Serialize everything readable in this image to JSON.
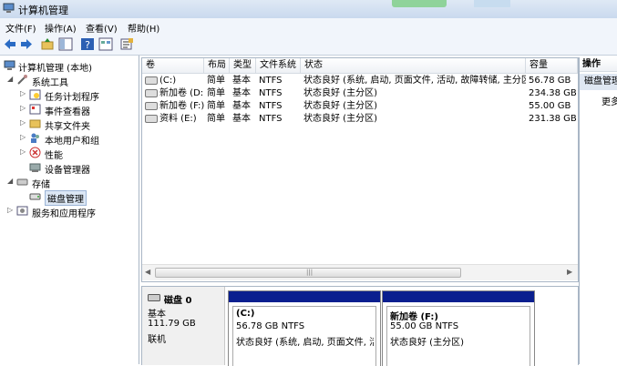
{
  "window": {
    "title": "计算机管理"
  },
  "menubar": {
    "items": [
      "文件(F)",
      "操作(A)",
      "查看(V)",
      "帮助(H)"
    ]
  },
  "tree": {
    "root": "计算机管理 (本地)",
    "items": [
      {
        "label": "系统工具",
        "expander": "◢"
      },
      {
        "label": "任务计划程序",
        "expander": "▷"
      },
      {
        "label": "事件查看器",
        "expander": "▷"
      },
      {
        "label": "共享文件夹",
        "expander": "▷"
      },
      {
        "label": "本地用户和组",
        "expander": "▷"
      },
      {
        "label": "性能",
        "expander": "▷"
      },
      {
        "label": "设备管理器",
        "expander": ""
      },
      {
        "label": "存储",
        "expander": "◢"
      },
      {
        "label": "磁盘管理",
        "expander": ""
      },
      {
        "label": "服务和应用程序",
        "expander": "▷"
      }
    ]
  },
  "volumes": {
    "columns": [
      "卷",
      "布局",
      "类型",
      "文件系统",
      "状态",
      "容量"
    ],
    "rows": [
      [
        "(C:)",
        "简单",
        "基本",
        "NTFS",
        "状态良好 (系统, 启动, 页面文件, 活动, 故障转储, 主分区)",
        "56.78 GB"
      ],
      [
        "新加卷 (D:)",
        "简单",
        "基本",
        "NTFS",
        "状态良好 (主分区)",
        "234.38 GB"
      ],
      [
        "新加卷 (F:)",
        "简单",
        "基本",
        "NTFS",
        "状态良好 (主分区)",
        "55.00 GB"
      ],
      [
        "资料 (E:)",
        "简单",
        "基本",
        "NTFS",
        "状态良好 (主分区)",
        "231.38 GB"
      ]
    ]
  },
  "disk": {
    "name": "磁盘 0",
    "type": "基本",
    "size": "111.79 GB",
    "status": "联机"
  },
  "partitions": [
    {
      "title": "(C:)",
      "size": "56.78 GB NTFS",
      "status": "状态良好 (系统, 启动, 页面文件, 活动"
    },
    {
      "title": "新加卷  (F:)",
      "size": "55.00 GB NTFS",
      "status": "状态良好 (主分区)"
    }
  ],
  "actions": {
    "header": "操作",
    "section": "磁盘管理",
    "more": "更多"
  },
  "colors": {
    "partition_bar": "#0a1f8f",
    "selection": "#dce7f5"
  }
}
